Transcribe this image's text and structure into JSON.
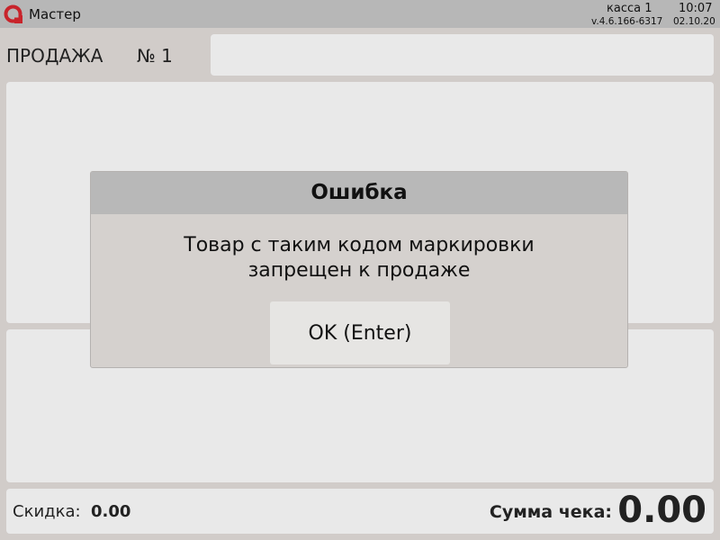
{
  "header": {
    "app_title": "Мастер",
    "register": "касса 1",
    "time": "10:07",
    "version": "v.4.6.166-6317",
    "date": "02.10.20"
  },
  "sale": {
    "title": "ПРОДАЖА",
    "number": "№ 1",
    "search_value": ""
  },
  "footer": {
    "discount_label": "Скидка:",
    "discount_value": "0.00",
    "total_label": "Сумма чека:",
    "total_value": "0.00"
  },
  "dialog": {
    "title": "Ошибка",
    "message_line1": "Товар с таким кодом маркировки",
    "message_line2": "запрещен к продаже",
    "ok_label": "OK (Enter)"
  },
  "colors": {
    "logo_red": "#c8242b",
    "topbar": "#b7b7b7",
    "background": "#d1ccc9",
    "panel": "#e9e9e9",
    "dialog_body": "#d5d1ce",
    "dialog_header": "#b8b8b8"
  },
  "icons": {
    "logo": "app-logo-icon"
  }
}
